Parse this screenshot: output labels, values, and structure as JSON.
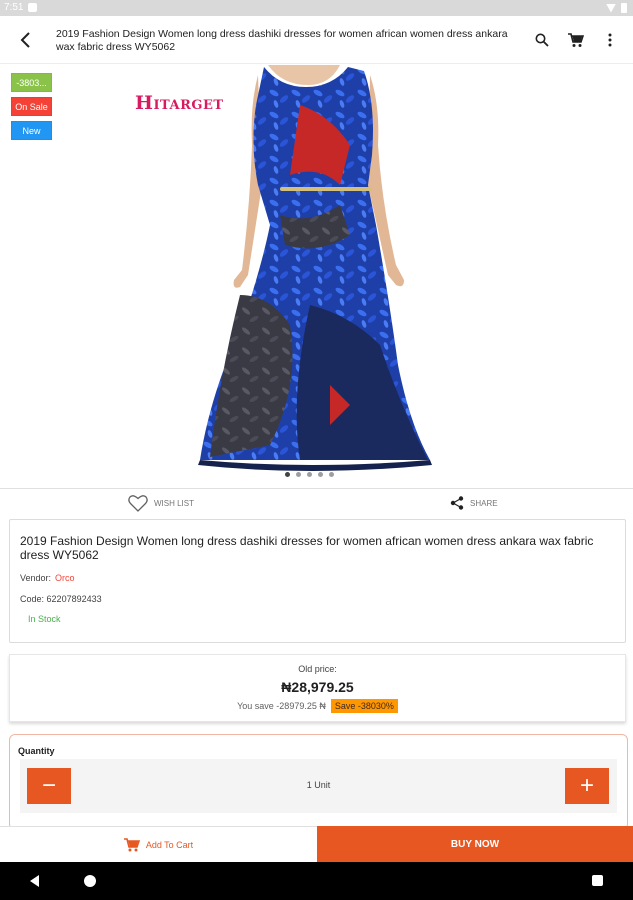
{
  "status_bar": {
    "time": "7:51"
  },
  "app_bar": {
    "title": "2019 Fashion Design Women long dress dashiki  dresses for women  african women dress ankara wax fabric dress  WY5062",
    "icons": [
      "back-arrow-icon",
      "search-icon",
      "cart-icon",
      "more-vert-icon"
    ]
  },
  "product_image": {
    "badges": {
      "discount": "-3803...",
      "sale": "On Sale",
      "new": "New"
    },
    "brand_logo": "Hitarget",
    "pager": {
      "count": 5,
      "active_index": 0
    }
  },
  "actions": {
    "wish_list": "WISH LIST",
    "share": "SHARE"
  },
  "product_info": {
    "title": "2019 Fashion Design Women long dress dashiki  dresses for women  african women dress ankara wax fabric dress  WY5062",
    "vendor_label": "Vendor:",
    "vendor_name": "Orco",
    "code_label": "Code:",
    "code_value": "62207892433",
    "stock": "In Stock"
  },
  "price": {
    "old_price_label": "Old price:",
    "current": "₦28,979.25",
    "you_save": "You save -28979.25 ₦",
    "save_badge": "Save -38030%"
  },
  "quantity": {
    "label": "Quantity",
    "value": "1 Unit",
    "minus": "−",
    "plus": "+"
  },
  "bottom_bar": {
    "add_to_cart": "Add To Cart",
    "buy_now": "BUY NOW"
  },
  "colors": {
    "accent": "#e65722",
    "sale": "#f44336",
    "new": "#2196f3",
    "discount": "#8bc34a",
    "stock": "#4caf50",
    "save_badge": "#ff9800"
  }
}
